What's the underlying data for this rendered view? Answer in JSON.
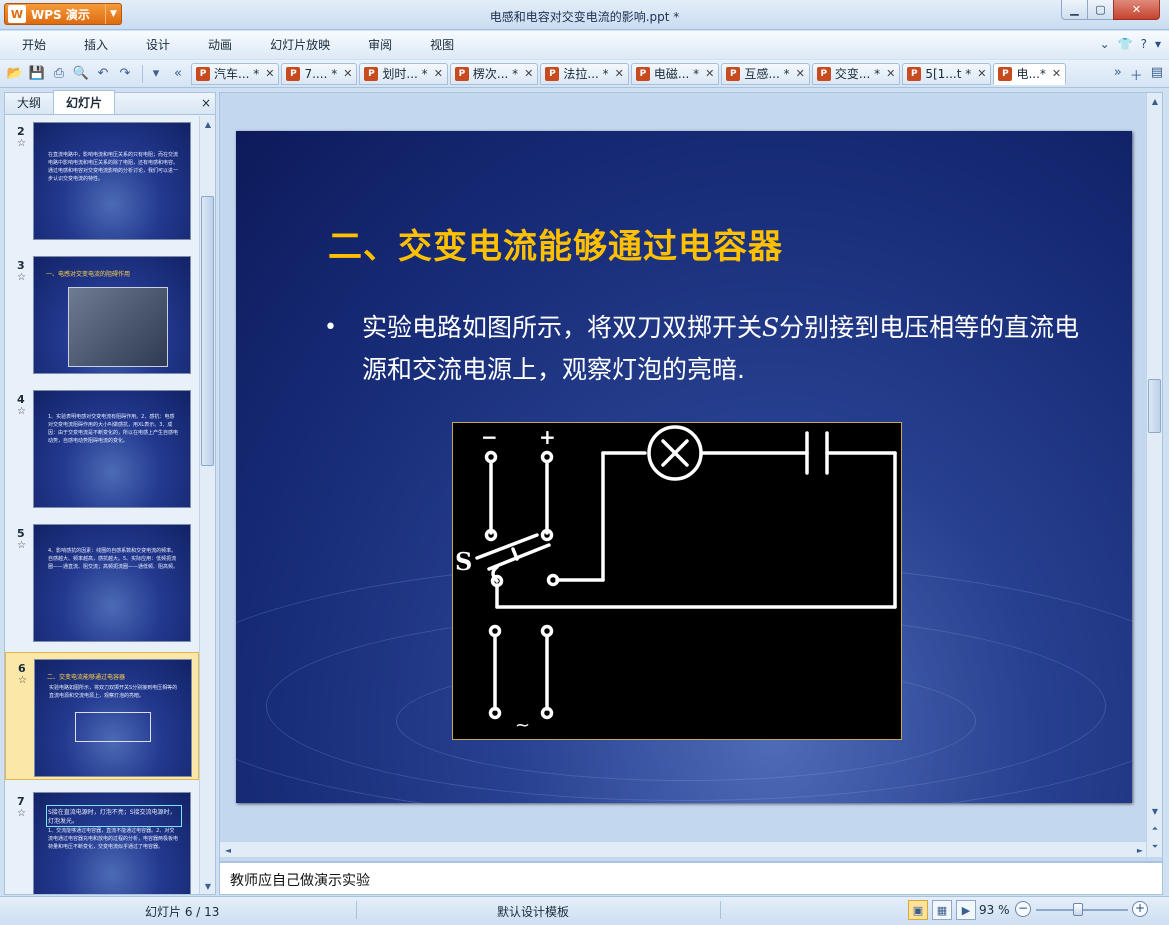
{
  "app": {
    "name": "WPS 演示",
    "logo_text": "W",
    "window_title": "电感和电容对交变电流的影响.ppt *"
  },
  "menu": [
    "开始",
    "插入",
    "设计",
    "动画",
    "幻灯片放映",
    "审阅",
    "视图"
  ],
  "doc_tabs": [
    {
      "label": "汽车... *",
      "active": false
    },
    {
      "label": "7.... *",
      "active": false
    },
    {
      "label": "划时... *",
      "active": false
    },
    {
      "label": "楞次... *",
      "active": false
    },
    {
      "label": "法拉... *",
      "active": false
    },
    {
      "label": "电磁... *",
      "active": false
    },
    {
      "label": "互感... *",
      "active": false
    },
    {
      "label": "交变... *",
      "active": false
    },
    {
      "label": "5[1...t *",
      "active": false
    },
    {
      "label": "电...*",
      "active": true
    }
  ],
  "left_pane": {
    "tab_outline": "大纲",
    "tab_slides": "幻灯片",
    "close": "×",
    "thumbnails": [
      {
        "num": "2",
        "star": "☆",
        "title": "",
        "text": "在直流电路中，影响电流和电压关系的只有电阻；而在交流电路中影响电流和电压关系的除了电阻，还有电感和电容。通过电感和电容对交变电流影响的分析讨论，我们可以进一步认识交变电流的特性。"
      },
      {
        "num": "3",
        "star": "☆",
        "title": "一、电感对交变电流的阻碍作用",
        "text": ""
      },
      {
        "num": "4",
        "star": "☆",
        "title": "",
        "text": "1、实验表明电感对交变电流有阻碍作用。2、感抗：电感对交变电流阻碍作用的大小叫做感抗，用XL表示。3、成因：由于交变电流是不断变化的，所以在电感上产生自感电动势，自感电动势阻碍电流的变化。"
      },
      {
        "num": "5",
        "star": "☆",
        "title": "",
        "text": "4、影响感抗的因素：线圈的自感系数和交变电流的频率。自感越大、频率越高，感抗越大。5、实际应用：低频扼流圈——通直流、阻交流；高频扼流圈——通低频、阻高频。"
      },
      {
        "num": "6",
        "star": "☆",
        "title": "二、交变电流能够通过电容器",
        "text": "实验电路如图所示，将双刀双掷开关S分别接到电压相等的直流电源和交流电源上，观察灯泡的亮暗。"
      },
      {
        "num": "7",
        "star": "☆",
        "title": "S接在直流电源时，灯泡不亮；S接交流电源时，灯泡发光。",
        "text": "1、交流能够通过电容器，直流不能通过电容器。2、对交流电通过电容器充电和放电的过程的分析，电容器两极板电荷量和电压不断变化，交变电流似乎通过了电容器。"
      }
    ]
  },
  "slide": {
    "title": "二、交变电流能够通过电容器",
    "bullet_mark": "•",
    "bullet_pre": "实验电路如图所示，将双刀双掷开关",
    "bullet_var": "S",
    "bullet_post": "分别接到电压相等的直流电源和交流电源上，观察灯泡的亮暗.",
    "circuit": {
      "minus": "−",
      "plus": "+",
      "switch_label": "S",
      "ac_symbol": "~",
      "lamp_symbol": "✕"
    }
  },
  "notes": "教师应自己做演示实验",
  "status": {
    "slide_info": "幻灯片 6 / 13",
    "template": "默认设计模板",
    "zoom": "93 %",
    "zoom_level_percent": 93
  },
  "colors": {
    "title_yellow": "#ffc000",
    "slide_blue": "#162a75",
    "app_orange": "#de6a10"
  }
}
